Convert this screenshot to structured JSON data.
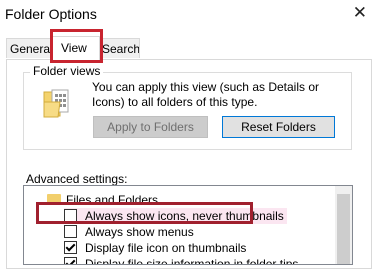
{
  "window": {
    "title": "Folder Options",
    "close_glyph": "✕"
  },
  "tabs": [
    {
      "label": "General"
    },
    {
      "label": "View",
      "active": true
    },
    {
      "label": "Search"
    }
  ],
  "folder_views": {
    "legend": "Folder views",
    "description": "You can apply this view (such as Details or Icons) to all folders of this type.",
    "apply_button": "Apply to Folders",
    "reset_button": "Reset Folders",
    "icon": "folder-view-icon"
  },
  "advanced": {
    "label": "Advanced settings:",
    "items": [
      {
        "type": "folder",
        "label": "Files and Folders"
      },
      {
        "type": "checkbox",
        "label": "Always show icons, never thumbnails",
        "checked": false
      },
      {
        "type": "checkbox",
        "label": "Always show menus",
        "checked": false
      },
      {
        "type": "checkbox",
        "label": "Display file icon on thumbnails",
        "checked": true
      },
      {
        "type": "checkbox",
        "label": "Display file size information in folder tips",
        "checked": true
      }
    ]
  },
  "colors": {
    "highlight_red": "#c8242f",
    "accent_blue": "#0078d7",
    "selected_row": "#fbe6f1"
  }
}
